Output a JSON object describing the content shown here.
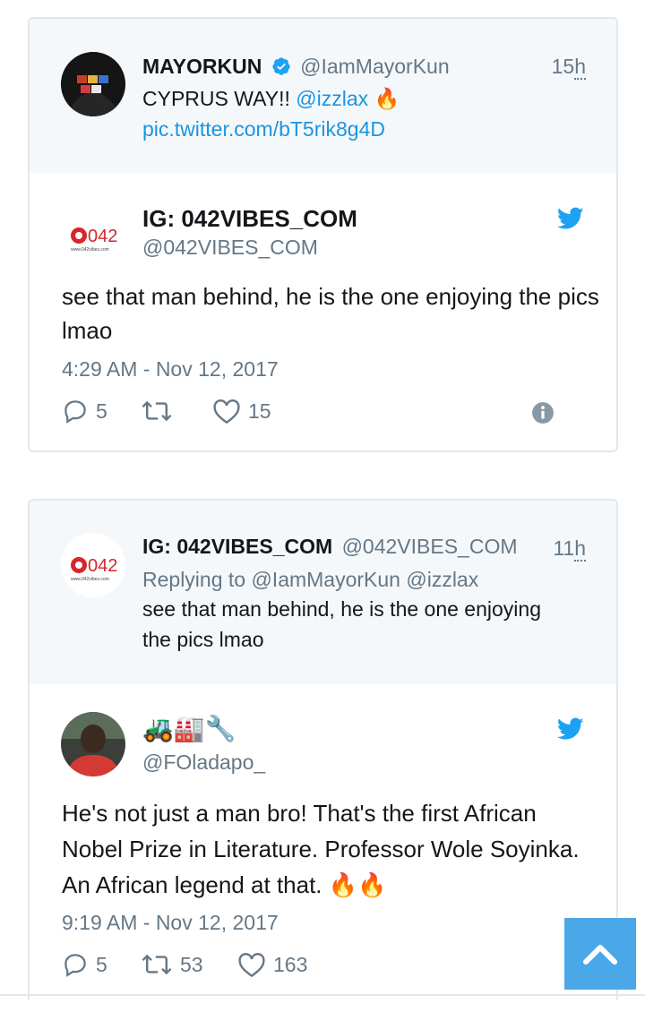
{
  "card1": {
    "quoted": {
      "name": "MAYORKUN",
      "handle": "@IamMayorKun",
      "time_num": "15",
      "time_unit": "h",
      "text": "CYPRUS WAY!! ",
      "mention": "@izzlax",
      "emoji": "🔥",
      "link": "pic.twitter.com/bT5rik8g4D"
    },
    "main": {
      "name": "IG: 042VIBES_COM",
      "handle": "@042VIBES_COM",
      "text": "see that man behind, he is the one enjoying the pics lmao",
      "date": "4:29 AM - Nov 12, 2017",
      "replies": "5",
      "retweets": "",
      "likes": "15"
    }
  },
  "card2": {
    "quoted": {
      "name": "IG: 042VIBES_COM",
      "handle": "@042VIBES_COM",
      "time_num": "11",
      "time_unit": "h",
      "replying": "Replying to @IamMayorKun @izzlax",
      "text": "see that man behind, he is the one enjoying the pics lmao"
    },
    "main": {
      "name_emojis": "🚜🏭🔧",
      "handle": "@FOladapo_",
      "text": "He's not just a man bro! That's the first African Nobel Prize in Literature. Professor Wole Soyinka. An African legend at that. ",
      "text_emojis": "🔥🔥",
      "date": "9:19 AM - Nov 12, 2017",
      "replies": "5",
      "retweets": "53",
      "likes": "163"
    }
  },
  "avatar_logo_text": "042",
  "avatar_logo_small": "www.042vibes.com",
  "colors": {
    "twitter_blue": "#1da1f2",
    "link_blue": "#1b95e0",
    "scroll_button": "#4aa8e8",
    "verified": "#1da1f2"
  },
  "icons": [
    "verified-badge-icon",
    "twitter-bird-icon",
    "reply-icon",
    "retweet-icon",
    "like-icon",
    "info-icon",
    "chevron-up-icon"
  ]
}
